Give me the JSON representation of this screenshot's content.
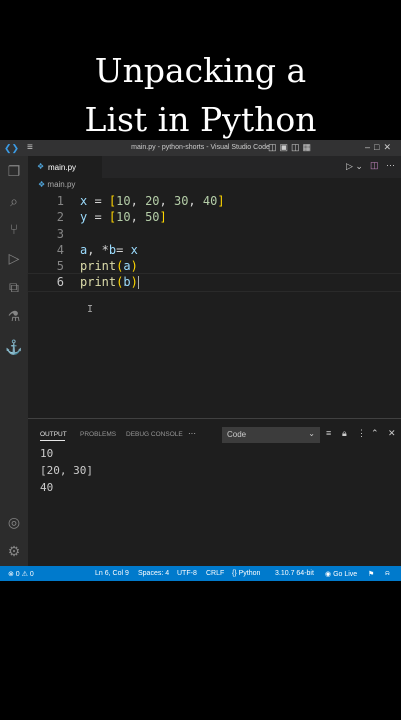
{
  "caption": {
    "line1": "Unpacking a",
    "line2": "List in Python"
  },
  "titlebar": {
    "title": "main.py - python-shorts - Visual Studio Code",
    "menu_icon": "hamburger-menu-icon",
    "logo_icon": "vscode-logo-icon"
  },
  "activity_bar": [
    "explorer-icon",
    "search-icon",
    "source-control-icon",
    "run-debug-icon",
    "extensions-icon",
    "testing-icon",
    "docker-icon",
    "account-icon",
    "settings-gear-icon"
  ],
  "editor": {
    "tab": "main.py",
    "breadcrumb": "main.py",
    "lines": [
      {
        "n": "1",
        "parts": [
          [
            "var",
            "x"
          ],
          [
            "op",
            " = "
          ],
          [
            "br1",
            "["
          ],
          [
            "num",
            "10"
          ],
          [
            "op",
            ", "
          ],
          [
            "num",
            "20"
          ],
          [
            "op",
            ", "
          ],
          [
            "num",
            "30"
          ],
          [
            "op",
            ", "
          ],
          [
            "num",
            "40"
          ],
          [
            "br1",
            "]"
          ]
        ]
      },
      {
        "n": "2",
        "parts": [
          [
            "var",
            "y"
          ],
          [
            "op",
            " = "
          ],
          [
            "br1",
            "["
          ],
          [
            "num",
            "10"
          ],
          [
            "op",
            ", "
          ],
          [
            "num",
            "50"
          ],
          [
            "br1",
            "]"
          ]
        ]
      },
      {
        "n": "3",
        "parts": []
      },
      {
        "n": "4",
        "parts": [
          [
            "var",
            "a"
          ],
          [
            "op",
            ", *"
          ],
          [
            "var",
            "b"
          ],
          [
            "op",
            "= "
          ],
          [
            "var",
            "x"
          ]
        ]
      },
      {
        "n": "5",
        "parts": [
          [
            "fn",
            "print"
          ],
          [
            "br1",
            "("
          ],
          [
            "var",
            "a"
          ],
          [
            "br1",
            ")"
          ]
        ]
      },
      {
        "n": "6",
        "parts": [
          [
            "fn",
            "print"
          ],
          [
            "br1",
            "("
          ],
          [
            "var",
            "b"
          ],
          [
            "br1",
            ")"
          ]
        ]
      }
    ],
    "active_line": "6"
  },
  "panel": {
    "tabs": [
      "OUTPUT",
      "PROBLEMS",
      "DEBUG CONSOLE"
    ],
    "more": "···",
    "channel": "Code",
    "output_lines": [
      "10",
      "[20, 30]",
      "40"
    ]
  },
  "statusbar": {
    "errors": "⊗ 0 ⚠ 0",
    "position": "Ln 6, Col 9",
    "spaces": "Spaces: 4",
    "encoding": "UTF-8",
    "eol": "CRLF",
    "language": "{} Python",
    "interpreter": "3.10.7 64-bit",
    "golive": "Go Live"
  }
}
